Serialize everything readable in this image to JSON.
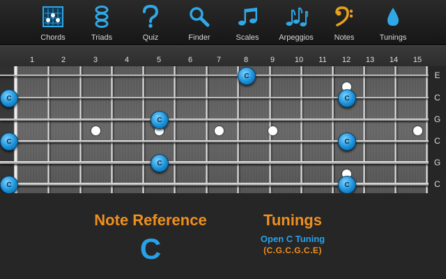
{
  "toolbar": {
    "items": [
      {
        "label": "Chords",
        "icon": "chord-diagram-icon"
      },
      {
        "label": "Triads",
        "icon": "triad-notes-icon"
      },
      {
        "label": "Quiz",
        "icon": "question-mark-icon"
      },
      {
        "label": "Finder",
        "icon": "magnifier-icon"
      },
      {
        "label": "Scales",
        "icon": "music-notes-icon"
      },
      {
        "label": "Arpeggios",
        "icon": "arpeggio-notes-icon"
      },
      {
        "label": "Notes",
        "icon": "bass-clef-icon"
      },
      {
        "label": "Tunings",
        "icon": "tuning-drop-icon"
      }
    ]
  },
  "fretboard": {
    "fret_numbers": [
      "1",
      "2",
      "3",
      "4",
      "5",
      "6",
      "7",
      "8",
      "9",
      "10",
      "11",
      "12",
      "13",
      "14",
      "15"
    ],
    "string_notes": [
      "E",
      "C",
      "G",
      "C",
      "G",
      "C"
    ],
    "inlay_frets": [
      3,
      5,
      7,
      9,
      15
    ],
    "double_inlay_fret": 12,
    "highlighted_notes": [
      {
        "label": "C",
        "string": 1,
        "fret": 8
      },
      {
        "label": "C",
        "string": 2,
        "fret": 0
      },
      {
        "label": "C",
        "string": 2,
        "fret": 12
      },
      {
        "label": "C",
        "string": 3,
        "fret": 5
      },
      {
        "label": "C",
        "string": 4,
        "fret": 0
      },
      {
        "label": "C",
        "string": 4,
        "fret": 12
      },
      {
        "label": "C",
        "string": 5,
        "fret": 5
      },
      {
        "label": "C",
        "string": 6,
        "fret": 0
      },
      {
        "label": "C",
        "string": 6,
        "fret": 12
      }
    ]
  },
  "note_reference": {
    "title": "Note Reference",
    "note": "C"
  },
  "tunings": {
    "title": "Tunings",
    "name": "Open C Tuning",
    "notes": "(C.G.C.G.C.E)"
  },
  "colors": {
    "accent_orange": "#f0901e",
    "accent_blue": "#27a2e8"
  }
}
